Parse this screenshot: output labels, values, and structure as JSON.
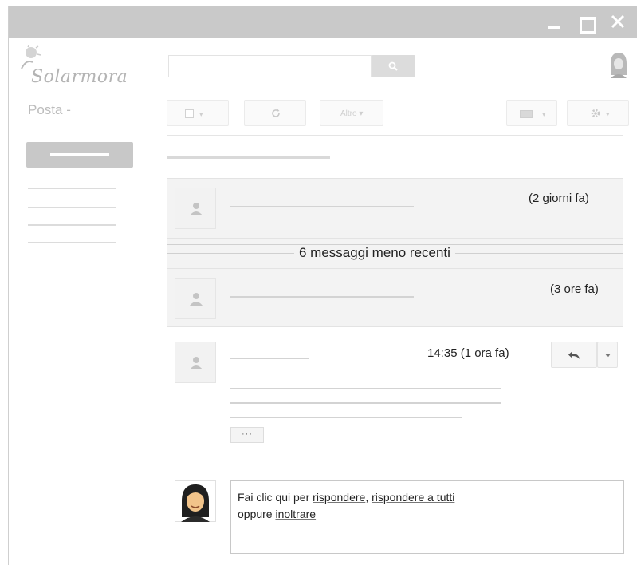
{
  "window": {
    "controls": {
      "minimize_icon": "minimize-icon",
      "maximize_icon": "maximize-icon",
      "close_icon": "close-icon"
    }
  },
  "header": {
    "logo_text": "Solarmora",
    "search": {
      "value": "",
      "placeholder": ""
    },
    "search_icon": "search-icon"
  },
  "sidebar": {
    "title": "Posta -"
  },
  "toolbar": {
    "select_caret": "▾",
    "altro_label": "Altro ▾",
    "keyboard_caret": "▾",
    "settings_caret": "▾"
  },
  "thread": {
    "messages": [
      {
        "time": "(2 giorni fa)"
      },
      {
        "time": "(3 ore fa)"
      }
    ],
    "collapsed_label": "6 messaggi meno recenti",
    "open_message": {
      "time": "14:35 (1 ora fa)",
      "ellipsis": "···"
    },
    "reply_box": {
      "prefix": "Fai clic qui per ",
      "reply": "rispondere",
      "comma": ", ",
      "reply_all": "rispondere a tutti",
      "middle": "oppure ",
      "forward": "inoltrare"
    }
  },
  "colors": {
    "titlebar": "#c9c9c9",
    "row_bg": "#f3f3f3",
    "compose": "#c8c8c8"
  }
}
